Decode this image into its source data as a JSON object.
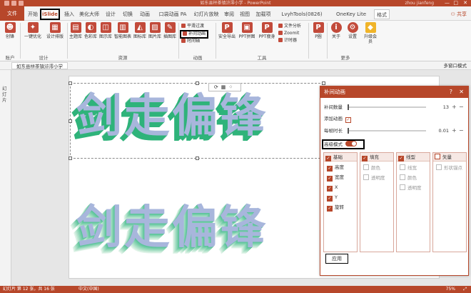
{
  "titlebar": {
    "title": "如东县栟茶镇浒澪小学 - PowerPoint",
    "user": "zhou jianfeng",
    "minimize": "—",
    "maximize": "□",
    "close": "✕"
  },
  "tabs": [
    {
      "label": "文件"
    },
    {
      "label": "开始"
    },
    {
      "label": "iSlide"
    },
    {
      "label": "插入"
    },
    {
      "label": "美化大师"
    },
    {
      "label": "设计"
    },
    {
      "label": "切换"
    },
    {
      "label": "动画"
    },
    {
      "label": "口袋动画 PA"
    },
    {
      "label": "幻灯片放映"
    },
    {
      "label": "审阅"
    },
    {
      "label": "视图"
    },
    {
      "label": "加载项"
    },
    {
      "label": "LvyhTools(0826)"
    },
    {
      "label": "OneKey Lite"
    },
    {
      "label": "格式"
    }
  ],
  "share": "共享",
  "ribbon": {
    "buttons": [
      {
        "label": "创锋",
        "icon": "user-icon"
      },
      {
        "label": "一键优化",
        "icon": "wand-icon"
      },
      {
        "label": "设计排版",
        "icon": "layout-icon"
      },
      {
        "label": "主题库",
        "icon": "theme-icon"
      },
      {
        "label": "色彩库",
        "icon": "palette-icon"
      },
      {
        "label": "图示库",
        "icon": "diagram-icon"
      },
      {
        "label": "智能图表",
        "icon": "chart-icon"
      },
      {
        "label": "图标库",
        "icon": "shape-icon"
      },
      {
        "label": "图片库",
        "icon": "picture-icon"
      },
      {
        "label": "插图库",
        "icon": "illustration-icon"
      },
      {
        "label": "安全导出",
        "icon": "export-icon"
      },
      {
        "label": "PPT拼图",
        "icon": "puzzle-icon"
      },
      {
        "label": "PPT瘦身",
        "icon": "slim-icon"
      },
      {
        "label": "P圈",
        "icon": "p-circle-icon"
      },
      {
        "label": "关于",
        "icon": "about-icon"
      },
      {
        "label": "设置",
        "icon": "gear-icon"
      },
      {
        "label": "升级会员",
        "icon": "diamond-icon"
      }
    ],
    "anim_small": [
      "平滑过渡",
      "补间动画",
      "时间轴"
    ],
    "tools_small": [
      "文件分析",
      "Zoomit",
      "计时器"
    ],
    "groups": [
      "账户",
      "设计",
      "资源",
      "动画",
      "工具",
      "更多"
    ]
  },
  "docbar": {
    "doc_tab": "如东县栟茶镇浒澪小学",
    "multi_window": "多窗口模式"
  },
  "leftpane": {
    "label": "幻灯片"
  },
  "slide": {
    "text_top": "剑走偏锋",
    "text_bottom": "剑走偏锋"
  },
  "panel": {
    "title": "补间动画",
    "help": "?",
    "close": "✕",
    "count_label": "补间数量",
    "count_value": "13",
    "add_anim_label": "添加动画",
    "duration_label": "每帧时长",
    "duration_value": "0.01",
    "advanced_label": "高级模式",
    "groups": [
      {
        "title": "基础",
        "items": [
          "高度",
          "宽度",
          "X",
          "Y",
          "旋转"
        ]
      },
      {
        "title": "填充",
        "items": [
          "颜色",
          "透明度"
        ]
      },
      {
        "title": "线型",
        "items": [
          "线宽",
          "颜色",
          "透明度"
        ]
      },
      {
        "title": "矢量",
        "items": [
          "形状锚点"
        ]
      }
    ],
    "apply": "应用"
  },
  "statusbar": {
    "slide": "幻灯片 第 12 张，共 16 张",
    "lang": "中文(中国)",
    "zoom": "75%"
  },
  "colors": {
    "accent": "#b7472a",
    "text_face": "#a8b6dc",
    "text_side": "#2fb37a"
  }
}
